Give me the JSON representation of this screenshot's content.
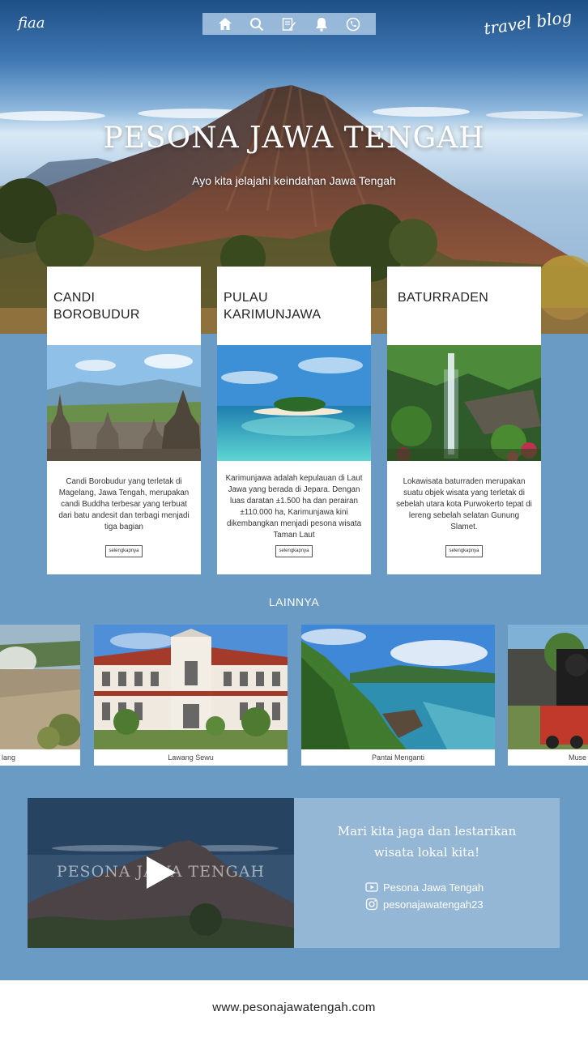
{
  "brand": {
    "left": "fiaa",
    "right": "travel blog"
  },
  "nav": {
    "icons": [
      "home-icon",
      "search-icon",
      "edit-icon",
      "bell-icon",
      "phone-icon"
    ]
  },
  "hero": {
    "title": "PESONA JAWA TENGAH",
    "subtitle": "Ayo kita jelajahi keindahan Jawa Tengah"
  },
  "cards": [
    {
      "title": "CANDI BOROBUDUR",
      "description": "Candi Borobudur yang terletak di Magelang, Jawa Tengah, merupakan candi Buddha terbesar yang terbuat dari batu andesit dan terbagi menjadi tiga bagian",
      "button": "selengkapnya"
    },
    {
      "title": "PULAU KARIMUNJAWA",
      "description": "Karimunjawa adalah kepulauan di Laut Jawa yang berada di Jepara. Dengan luas daratan ±1.500 ha dan perairan ±110.000 ha, Karimunjawa kini dikembangkan menjadi pesona wisata Taman Laut",
      "button": "selengkapnya"
    },
    {
      "title": "BATURRADEN",
      "description": "Lokawisata baturraden merupakan suatu objek wisata yang terletak di sebelah utara kota Purwokerto tepat di lereng sebelah selatan Gunung Slamet.",
      "button": "selengkapnya"
    }
  ],
  "others": {
    "title": "LAINNYA",
    "items": [
      {
        "caption": "lang"
      },
      {
        "caption": "Lawang Sewu"
      },
      {
        "caption": "Pantai Menganti"
      },
      {
        "caption": "Muse"
      }
    ]
  },
  "video": {
    "title": "PESONA JAWA TENGAH"
  },
  "info": {
    "line1": "Mari kita jaga dan lestarikan",
    "line2": "wisata lokal kita!",
    "youtube": "Pesona Jawa Tengah",
    "instagram": "pesonajawatengah23"
  },
  "footer": {
    "url": "www.pesonajawatengah.com"
  },
  "colors": {
    "page_bg": "#6a9bc4",
    "info_panel": "#94b7d6",
    "nav_bar": "#aac8e4"
  }
}
